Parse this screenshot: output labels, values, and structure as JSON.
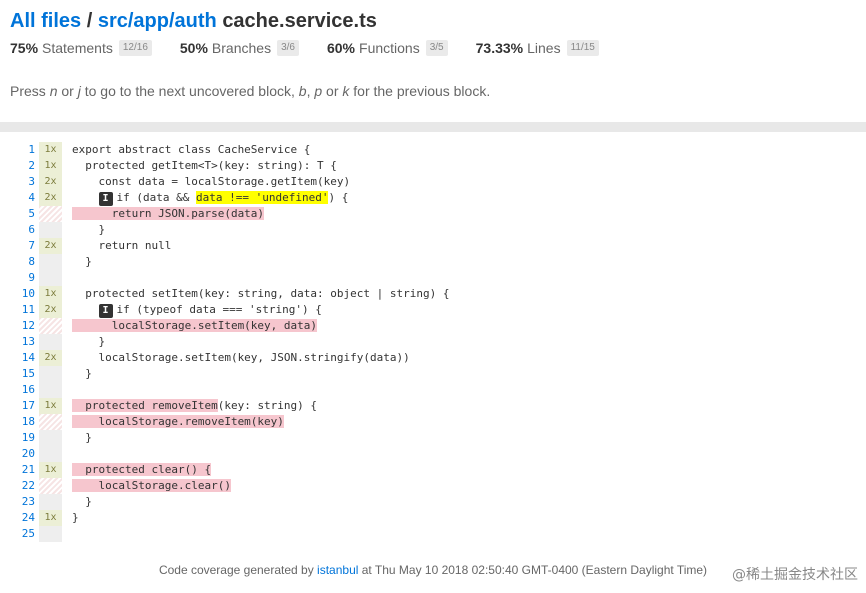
{
  "breadcrumb": {
    "root": "All files",
    "sep": "/",
    "dir": "src/app/auth",
    "file": "cache.service.ts"
  },
  "stats": [
    {
      "pct": "75%",
      "label": "Statements",
      "frac": "12/16"
    },
    {
      "pct": "50%",
      "label": "Branches",
      "frac": "3/6"
    },
    {
      "pct": "60%",
      "label": "Functions",
      "frac": "3/5"
    },
    {
      "pct": "73.33%",
      "label": "Lines",
      "frac": "11/15"
    }
  ],
  "hint": {
    "t1": "Press ",
    "k1": "n",
    "t2": " or ",
    "k2": "j",
    "t3": " to go to the next uncovered block, ",
    "k3": "b",
    "t4": ", ",
    "k4": "p",
    "t5": " or ",
    "k5": "k",
    "t6": " for the previous block."
  },
  "lines": [
    {
      "n": "1",
      "hits": "1x",
      "type": "hit",
      "segs": [
        {
          "t": "export abstract class CacheService {"
        }
      ]
    },
    {
      "n": "2",
      "hits": "1x",
      "type": "hit",
      "segs": [
        {
          "t": "  protected getItem<T>(key: string): T {"
        }
      ]
    },
    {
      "n": "3",
      "hits": "2x",
      "type": "hit",
      "segs": [
        {
          "t": "    const data = localStorage.getItem(key)"
        }
      ]
    },
    {
      "n": "4",
      "hits": "2x",
      "type": "hit",
      "badge": "I",
      "segs": [
        {
          "t": "    "
        },
        {
          "badge": "I"
        },
        {
          "t": "if (data && "
        },
        {
          "t": "data !== 'undefined'",
          "c": "yl"
        },
        {
          "t": ") {"
        }
      ]
    },
    {
      "n": "5",
      "hits": "",
      "type": "miss",
      "segs": [
        {
          "t": "      return JSON.parse(data)",
          "c": "hl"
        }
      ]
    },
    {
      "n": "6",
      "hits": "",
      "type": "none",
      "segs": [
        {
          "t": "    }"
        }
      ]
    },
    {
      "n": "7",
      "hits": "2x",
      "type": "hit",
      "segs": [
        {
          "t": "    return null"
        }
      ]
    },
    {
      "n": "8",
      "hits": "",
      "type": "none",
      "segs": [
        {
          "t": "  }"
        }
      ]
    },
    {
      "n": "9",
      "hits": "",
      "type": "none",
      "segs": [
        {
          "t": ""
        }
      ]
    },
    {
      "n": "10",
      "hits": "1x",
      "type": "hit",
      "segs": [
        {
          "t": "  protected setItem(key: string, data: object | string) {"
        }
      ]
    },
    {
      "n": "11",
      "hits": "2x",
      "type": "hit",
      "segs": [
        {
          "t": "    "
        },
        {
          "badge": "I"
        },
        {
          "t": "if (typeof data === 'string') {"
        }
      ]
    },
    {
      "n": "12",
      "hits": "",
      "type": "miss",
      "segs": [
        {
          "t": "      localStorage.setItem(key, data)",
          "c": "hl"
        }
      ]
    },
    {
      "n": "13",
      "hits": "",
      "type": "none",
      "segs": [
        {
          "t": "    }"
        }
      ]
    },
    {
      "n": "14",
      "hits": "2x",
      "type": "hit",
      "segs": [
        {
          "t": "    localStorage.setItem(key, JSON.stringify(data))"
        }
      ]
    },
    {
      "n": "15",
      "hits": "",
      "type": "none",
      "segs": [
        {
          "t": "  }"
        }
      ]
    },
    {
      "n": "16",
      "hits": "",
      "type": "none",
      "segs": [
        {
          "t": ""
        }
      ]
    },
    {
      "n": "17",
      "hits": "1x",
      "type": "hit",
      "segs": [
        {
          "t": "  protected removeItem",
          "c": "hl"
        },
        {
          "t": "(key: string) {"
        }
      ]
    },
    {
      "n": "18",
      "hits": "",
      "type": "miss",
      "segs": [
        {
          "t": "    localStorage.removeItem(key)",
          "c": "hl"
        }
      ]
    },
    {
      "n": "19",
      "hits": "",
      "type": "none",
      "segs": [
        {
          "t": "  }"
        }
      ]
    },
    {
      "n": "20",
      "hits": "",
      "type": "none",
      "segs": [
        {
          "t": ""
        }
      ]
    },
    {
      "n": "21",
      "hits": "1x",
      "type": "hit",
      "segs": [
        {
          "t": "  protected clear() {",
          "c": "hl"
        }
      ]
    },
    {
      "n": "22",
      "hits": "",
      "type": "miss",
      "segs": [
        {
          "t": "    localStorage.clear()",
          "c": "hl"
        }
      ]
    },
    {
      "n": "23",
      "hits": "",
      "type": "none",
      "segs": [
        {
          "t": "  }"
        }
      ]
    },
    {
      "n": "24",
      "hits": "1x",
      "type": "hit",
      "segs": [
        {
          "t": "}"
        }
      ]
    },
    {
      "n": "25",
      "hits": "",
      "type": "none",
      "segs": [
        {
          "t": ""
        }
      ]
    }
  ],
  "footer": {
    "pre": "Code coverage generated by ",
    "link": "istanbul",
    "post": " at Thu May 10 2018 02:50:40 GMT-0400 (Eastern Daylight Time)"
  },
  "watermark": "@稀土掘金技术社区"
}
